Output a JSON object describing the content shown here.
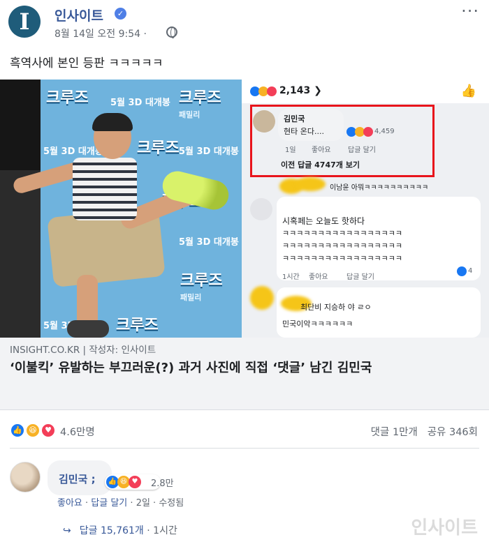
{
  "header": {
    "page_avatar_letter": "I",
    "page_name": "인사이트",
    "verified_icon": "✓",
    "post_time": "8월 14일 오전 9:54 ·",
    "more_icon": "···"
  },
  "caption": "흑역사에 본인 등판 ㅋㅋㅋㅋㅋ",
  "photo": {
    "poster_logo": "크루즈",
    "poster_sub": "패밀리",
    "poster_date": "5월 3D 대개봉",
    "fb_screenshot": {
      "reaction_count": "2,143",
      "comment_1_name": "김민국",
      "comment_1_text": "현타 온다....",
      "comment_1_reactions": "4,459",
      "comment_1_meta": [
        "1일",
        "좋아요",
        "답글 달기"
      ],
      "comment_1_replies": "이전 답글 4747개 보기",
      "blurred_line": "이남윤 아뭐ㅋㅋㅋㅋㅋㅋㅋㅋㅋㅋ",
      "comment_2_text": "시혹페는 오늘도 핫하다",
      "comment_2_laugh_1": "ㅋㅋㅋㅋㅋㅋㅋㅋㅋㅋㅋㅋㅋㅋㅋㅋㅋ",
      "comment_2_laugh_2": "ㅋㅋㅋㅋㅋㅋㅋㅋㅋㅋㅋㅋㅋㅋㅋㅋㅋ",
      "comment_2_laugh_3": "ㅋㅋㅋㅋㅋㅋㅋㅋㅋㅋㅋㅋㅋㅋㅋㅋㅋ",
      "comment_2_meta": [
        "1시간",
        "좋아요",
        "답글 달기"
      ],
      "comment_2_reactions": "4",
      "comment_3_text_1": "최단비 지승하 야 ㄹㅇ",
      "comment_3_text_2": "민국이악ㅋㅋㅋㅋㅋㅋ"
    }
  },
  "link": {
    "source": "INSIGHT.CO.KR | 작성자: 인사이트",
    "title": "‘이불킥’ 유발하는 부끄러운(?) 과거 사진에 직접 ‘댓글’ 남긴 김민국"
  },
  "reactions": {
    "count": "4.6만명",
    "comments": "댓글 1만개",
    "shares": "공유 346회"
  },
  "comment": {
    "name": "김민국",
    "colon": ";",
    "reaction_count": "2.8만",
    "actions": [
      "좋아요",
      "답글 달기",
      "2일",
      "수정됨"
    ],
    "reply_arrow": "↪",
    "replies": "답글 15,761개",
    "reply_time": "1시간"
  },
  "watermark": "인사이트",
  "colors": {
    "link_blue": "#385898",
    "like_blue": "#1877f2",
    "haha_yellow": "#f7b125",
    "love_red": "#f33e58",
    "highlight_red": "#e8141b"
  }
}
